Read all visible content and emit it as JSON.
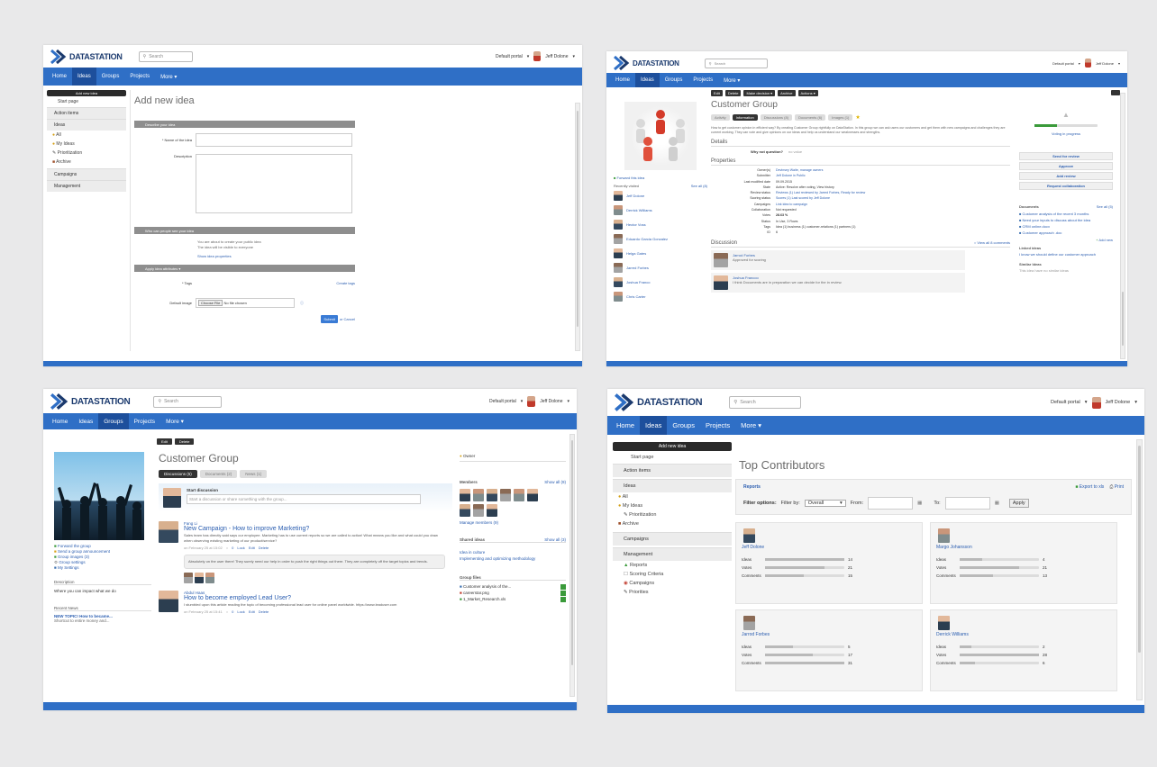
{
  "brand": {
    "name": "DATASTATION",
    "accent": "#2f6fc6",
    "dark_nav": "#1d4f9c"
  },
  "common": {
    "search_placeholder": "Search",
    "portal": "Default portal",
    "user": "Jeff Dolone",
    "nav": [
      "Home",
      "Ideas",
      "Groups",
      "Projects",
      "More ▾"
    ]
  },
  "s1": {
    "sidebar": {
      "add_button": "Add new idea",
      "items": [
        "Start page",
        "Action items",
        "Ideas",
        "All",
        "My Ideas",
        "Prioritization",
        "Archive",
        "Campaigns",
        "Management"
      ]
    },
    "title": "Add new idea",
    "section_describe": "Describe your idea",
    "name_label": "* Name of the idea",
    "description_label": "Description",
    "section_people": "Who can people see your idea",
    "visibility_lines": [
      "You are about to create your public idea",
      "The idea will be visible to everyone",
      "Show idea properties"
    ],
    "section_apply": "Apply idea attributes ▾",
    "tags_label": "* Tags",
    "tags_link": "Create tags",
    "default_image_label": "Default image",
    "file_button": "Choose File",
    "file_status": "No file chosen",
    "submit": "Submit",
    "cancel": "or Cancel"
  },
  "s2": {
    "toolbar": [
      "Edit",
      "Delete",
      "Make decision ▾",
      "Archive",
      "Actions ▾"
    ],
    "title": "Customer Group",
    "tabs": [
      "Activity",
      "Information",
      "Discussions (8)",
      "Documents (6)",
      "Images (1)"
    ],
    "description": "How to get customer opinion in efficient way? By creating Customer Group rightfully on DataStation. In this group we can ask users our customers and get them with new campaigns and challenges they are current working. They can vote and give opinions on our ideas and help us understand our weaknesses and strengths.",
    "left": {
      "forward": "Forward this idea",
      "recently": "Recently visited",
      "see_all": "See all (8)",
      "people": [
        "Jeff Dolone",
        "Derrick Williams",
        "Hector Voss",
        "Eduardo Garcia Gonzalez",
        "Helga Gates",
        "Jarred Forbes",
        "Joshua Franco",
        "Chris Carter"
      ]
    },
    "sections": {
      "details": "Details",
      "properties": "Properties",
      "discussion": "Discussion",
      "view_all": "View all 8 comments"
    },
    "details_row": {
      "label": "Why not question?",
      "value": "no value"
    },
    "props": [
      {
        "k": "Owner(s)",
        "v": "Devinsey Waite, manage owners"
      },
      {
        "k": "Submitter",
        "v": "Jeff Dolone in Public"
      },
      {
        "k": "Last modified date",
        "v": "09.09.2015"
      },
      {
        "k": "State",
        "v": "Active: Resolve after voting, View history"
      },
      {
        "k": "Review status",
        "v": "Reviews (1) Last reviewed by Jarred Forbes, Ready for review"
      },
      {
        "k": "Scoring status",
        "v": "Scores (1) Last scored by Jeff Dolone"
      },
      {
        "k": "Campaigns",
        "v": "Link idea to campaign"
      },
      {
        "k": "Collaboration",
        "v": "Not requested"
      },
      {
        "k": "Votes",
        "v": "28.63 %"
      },
      {
        "k": "Status",
        "v": "In Use, 3 Rows"
      },
      {
        "k": "Tags",
        "v": "Idea (1)  business (1)  customer-relations (1)  partners (1)"
      },
      {
        "k": "ID",
        "v": "6"
      }
    ],
    "comments": [
      {
        "name": "Jarrod Forbes",
        "text": "Approved for scoring"
      },
      {
        "name": "Joshua Francoo",
        "text": "I think Documents are in preparation we can decide for the in review."
      }
    ],
    "right": {
      "progress_label": "Voting in progress",
      "buttons": [
        "Send for review",
        "Approve",
        "Add review",
        "Request collaboration"
      ],
      "documents_title": "Documents",
      "documents": [
        "Customer analysis of the recent 3 months",
        "Need your inputs to discuss about the idea",
        "CRM online.docx",
        "Customer approach .doc"
      ],
      "add_new": "Add new",
      "links_title": "Linked ideas",
      "links_item": "I know we should define our customer approach",
      "similar_title": "Similar Ideas",
      "similar_text": "This idea have no similar ideas",
      "see_all": "See all (5)",
      "progress": 0.35
    }
  },
  "s3": {
    "toolbar": [
      "Edit",
      "Delete"
    ],
    "title": "Customer Group",
    "tabs": [
      "Discussions (5)",
      "Documents (2)",
      "News (1)"
    ],
    "start_label": "Start discussion",
    "start_placeholder": "Start a discussion or share something with the group...",
    "left": {
      "links": [
        "Forward the group",
        "Send a group announcement",
        "Group images (3)",
        "Group settings",
        "My Settings"
      ],
      "description_title": "Description",
      "description_text": "Where you can impact what we do",
      "recent_title": "Recent News",
      "recent_link": "NEW TOPIC! How to became...",
      "recent_text": "Shortcut to entire money and..."
    },
    "posts": [
      {
        "author": "Fang Li",
        "title": "New Campaign - How to improve Marketing?",
        "body": "Sales team has directly said says our employee. Marketing has to use current reports so we are called to action! What means you like and what could you draw when observing existing marketing of our product/service?",
        "meta": "on February 25 at 15:02",
        "actions": [
          "0",
          "Lock",
          "Edit",
          "Delete"
        ],
        "reply": "Absolutely on the user there! They surely need our help in order to push the right things out there. They are completely off the target topics and trends."
      },
      {
        "author": "Abdul Haas",
        "title": "How to become employed Lead User?",
        "body": "I stumbled upon this article reading the topic of becoming professional lead user for online panel worldwide. https://www.leaduser.com",
        "meta": "on February 25 at 15:41",
        "actions": [
          "0",
          "Lock",
          "Edit",
          "Delete"
        ]
      }
    ],
    "right": {
      "owner": "Owner",
      "members_title": "Members",
      "members_all": "Show all (9)",
      "manage": "Manage members (9)",
      "shared_title": "Shared ideas",
      "shared_all": "Show all (3)",
      "shared": [
        "Idea in culture",
        "Implementing and optimizing methodology"
      ],
      "files_title": "Group files",
      "files": [
        "Customer analysis of the...",
        "careerstar.png",
        "1_Market_Research.xls"
      ]
    }
  },
  "s4": {
    "sidebar": {
      "add_button": "Add new idea",
      "items": [
        "Start page",
        "Action items",
        "Ideas",
        "All",
        "My Ideas",
        "Prioritization",
        "Archive",
        "Campaigns",
        "Management"
      ],
      "sub": [
        "Reports",
        "Scoring Criteria",
        "Campaigns",
        "Priorities"
      ]
    },
    "title": "Top Contributors",
    "reports": "Reports",
    "export": "Export to xls",
    "print": "Print",
    "filter_label": "Filter options:",
    "filter_by_label": "Filter by:",
    "filter_by_value": "Overall",
    "from_label": "From:",
    "to_label": "To:",
    "apply": "Apply",
    "metric_labels": [
      "Ideas",
      "Votes",
      "Comments"
    ],
    "cards": [
      {
        "name": "Jeff Dolone",
        "ideas": 14,
        "votes": 21,
        "comments": 15
      },
      {
        "name": "Margo Johansson",
        "ideas": 4,
        "votes": 21,
        "comments": 13
      },
      {
        "name": "Jarrod Forbes",
        "ideas": 5,
        "votes": 17,
        "comments": 31
      },
      {
        "name": "Derrick Williams",
        "ideas": 2,
        "votes": 28,
        "comments": 6
      }
    ]
  }
}
